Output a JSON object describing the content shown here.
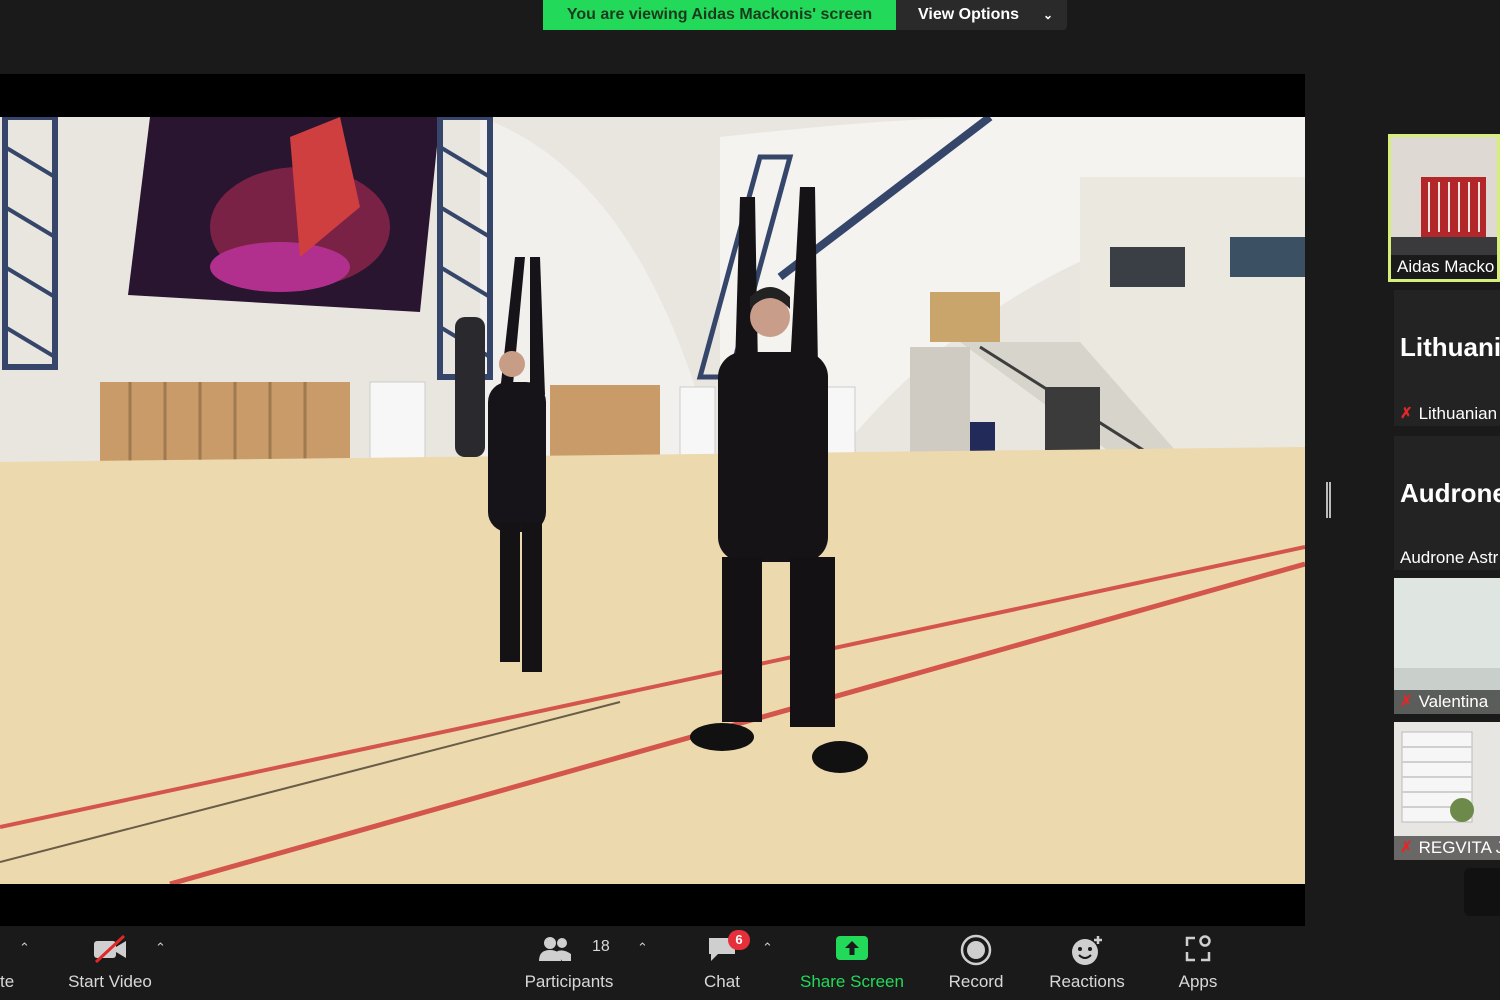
{
  "banner": {
    "viewing_text": "You are viewing Aidas Mackonis' screen",
    "view_options_label": "View Options"
  },
  "participants_panel": {
    "tiles": [
      {
        "name": "Aidas Macko",
        "active_speaker": true
      },
      {
        "big_name": "Lithuani",
        "name": "Lithuanian",
        "muted": true
      },
      {
        "big_name": "Audrone",
        "name": "Audrone Astr",
        "muted": false
      },
      {
        "name": "Valentina",
        "muted": true
      },
      {
        "name": "REGVITA J",
        "muted": true
      }
    ]
  },
  "toolbar": {
    "mute_label": "te",
    "start_video_label": "Start Video",
    "participants_label": "Participants",
    "participants_count": "18",
    "chat_label": "Chat",
    "chat_badge": "6",
    "share_screen_label": "Share Screen",
    "record_label": "Record",
    "reactions_label": "Reactions",
    "apps_label": "Apps"
  },
  "colors": {
    "accent_green": "#23d959",
    "badge_red": "#e5303b",
    "active_border": "#d6ef7a"
  }
}
